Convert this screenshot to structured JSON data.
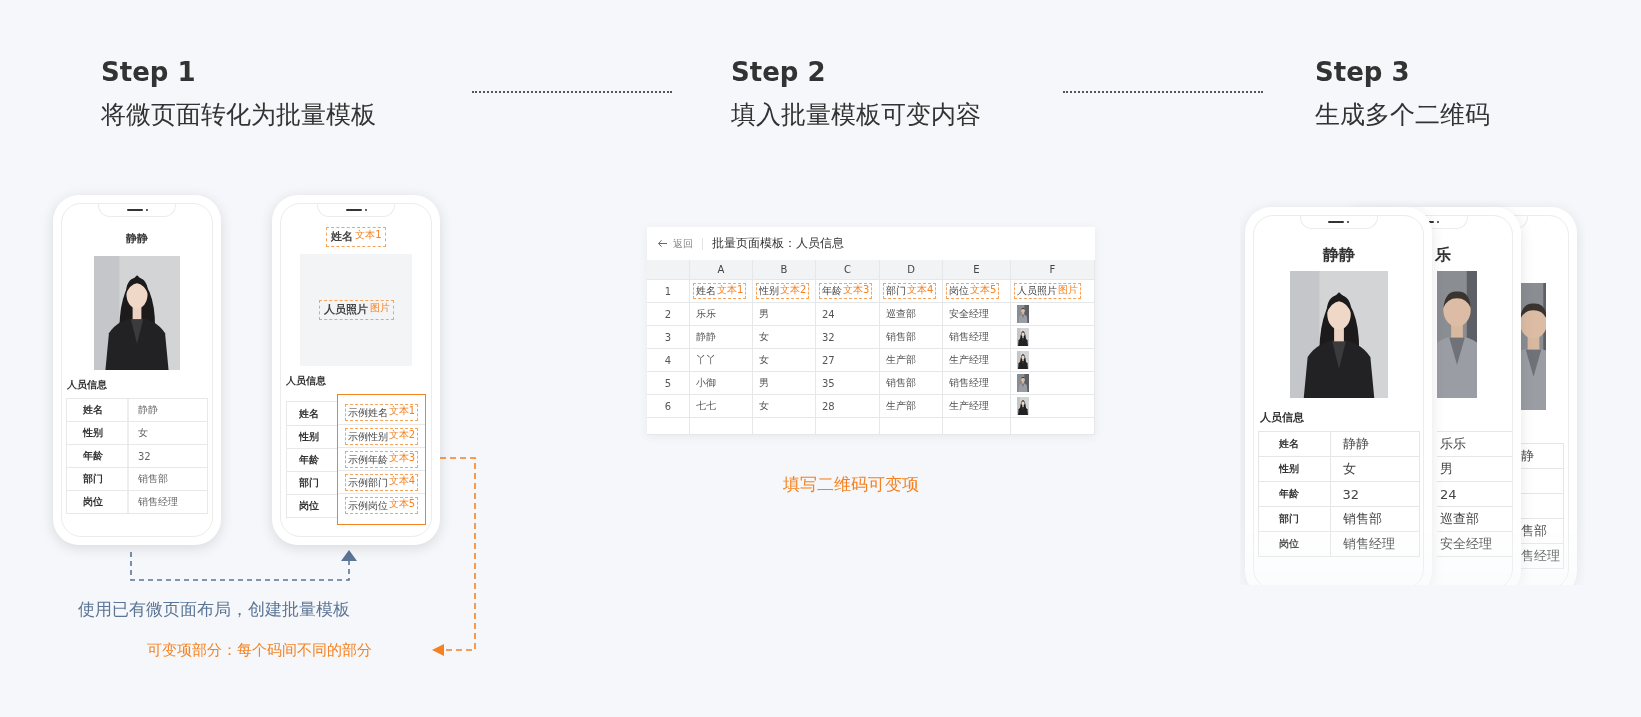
{
  "steps": [
    {
      "step": "Step 1",
      "title": "将微页面转化为批量模板"
    },
    {
      "step": "Step 2",
      "title": "填入批量模板可变内容"
    },
    {
      "step": "Step 3",
      "title": "生成多个二维码"
    }
  ],
  "template_phone": {
    "name": "静静",
    "section": "人员信息",
    "rows": [
      {
        "label": "姓名",
        "value": "静静"
      },
      {
        "label": "性别",
        "value": "女"
      },
      {
        "label": "年龄",
        "value": "32"
      },
      {
        "label": "部门",
        "value": "销售部"
      },
      {
        "label": "岗位",
        "value": "销售经理"
      }
    ]
  },
  "tagged_phone": {
    "name_tag": {
      "label": "姓名",
      "tag": "文本1"
    },
    "photo_tag": {
      "label": "人员照片",
      "tag": "图片"
    },
    "section": "人员信息",
    "rows": [
      {
        "label": "姓名",
        "sample": "示例姓名",
        "tag": "文本1"
      },
      {
        "label": "性别",
        "sample": "示例性别",
        "tag": "文本2"
      },
      {
        "label": "年龄",
        "sample": "示例年龄",
        "tag": "文本3"
      },
      {
        "label": "部门",
        "sample": "示例部门",
        "tag": "文本4"
      },
      {
        "label": "岗位",
        "sample": "示例岗位",
        "tag": "文本5"
      }
    ]
  },
  "create_caption": "使用已有微页面布局，创建批量模板",
  "variable_caption": "可变项部分：每个码间不同的部分",
  "sheet": {
    "back": "返回",
    "title": "批量页面模板：人员信息",
    "columns": [
      "A",
      "B",
      "C",
      "D",
      "E",
      "F"
    ],
    "header_row": {
      "number": "1",
      "cells": [
        {
          "label": "姓名",
          "tag": "文本1"
        },
        {
          "label": "性别",
          "tag": "文本2"
        },
        {
          "label": "年龄",
          "tag": "文本3"
        },
        {
          "label": "部门",
          "tag": "文本4"
        },
        {
          "label": "岗位",
          "tag": "文本5"
        },
        {
          "label": "人员照片",
          "tag": "图片"
        }
      ]
    },
    "rows": [
      {
        "number": "2",
        "cells": [
          "乐乐",
          "男",
          "24",
          "巡查部",
          "安全经理"
        ]
      },
      {
        "number": "3",
        "cells": [
          "静静",
          "女",
          "32",
          "销售部",
          "销售经理"
        ]
      },
      {
        "number": "4",
        "cells": [
          "丫丫",
          "女",
          "27",
          "生产部",
          "生产经理"
        ]
      },
      {
        "number": "5",
        "cells": [
          "小御",
          "男",
          "35",
          "销售部",
          "销售经理"
        ]
      },
      {
        "number": "6",
        "cells": [
          "七七",
          "女",
          "28",
          "生产部",
          "生产经理"
        ]
      }
    ]
  },
  "sheet_caption": "填写二维码可变项",
  "generated_phones": [
    {
      "name": "静静",
      "section": "人员信息",
      "rows": [
        {
          "label": "姓名",
          "value": "静静"
        },
        {
          "label": "性别",
          "value": "女"
        },
        {
          "label": "年龄",
          "value": "32"
        },
        {
          "label": "部门",
          "value": "销售部"
        },
        {
          "label": "岗位",
          "value": "销售经理"
        }
      ]
    },
    {
      "name": "乐",
      "rows": [
        {
          "value": "乐乐"
        },
        {
          "value": "男"
        },
        {
          "value": "24"
        },
        {
          "value": "巡查部"
        },
        {
          "value": "安全经理"
        }
      ]
    },
    {
      "rows": [
        {
          "value": "静"
        },
        {},
        {},
        {
          "value": "售部"
        },
        {
          "value": "售经理"
        }
      ]
    }
  ]
}
